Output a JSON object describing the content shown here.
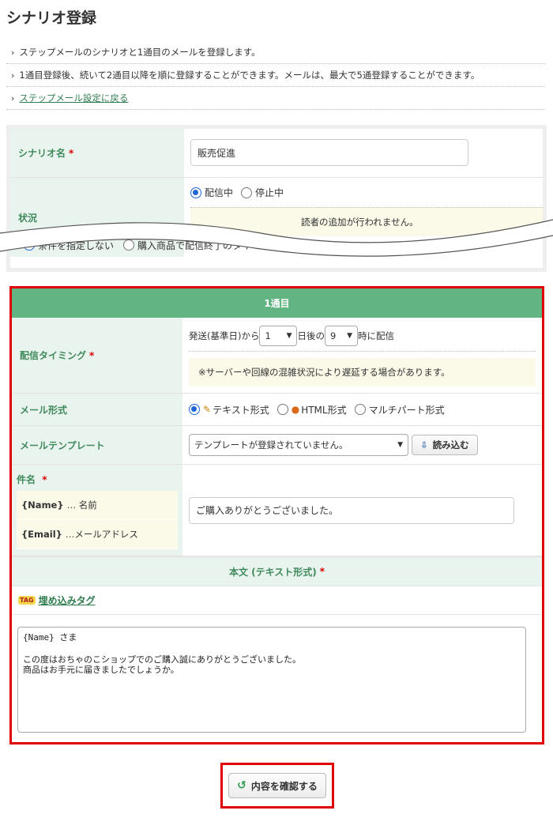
{
  "page_title": "シナリオ登録",
  "notes": [
    "ステップメールのシナリオと1通目のメールを登録します。",
    "1通目登録後、続いて2通目以降を順に登録することができます。メールは、最大で5通登録することができます。"
  ],
  "back_link": "ステップメール設定に戻る",
  "scenario": {
    "name_label": "シナリオ名",
    "required_mark": "*",
    "name_value": "販売促進",
    "status_label": "状況",
    "status_options": [
      "配信中",
      "停止中"
    ],
    "status_notice_partial": "読者の追加が行われません。",
    "condition_options_partial": [
      "条件を指定しない",
      "購入商品で配信終了のタイミング"
    ]
  },
  "mail1": {
    "header": "1通目",
    "timing_label": "配信タイミング",
    "timing_prefix": "発送(基準日)から",
    "timing_day": "1",
    "timing_mid": "日後の",
    "timing_hour": "9",
    "timing_suffix": "時に配信",
    "timing_notice": "※サーバーや回線の混雑状況により遅延する場合があります。",
    "format_label": "メール形式",
    "format_options": [
      "テキスト形式",
      "HTML形式",
      "マルチパート形式"
    ],
    "template_label": "メールテンプレート",
    "template_value": "テンプレートが登録されていません。",
    "load_button": "読み込む",
    "subject_label": "件名",
    "tags": [
      {
        "tag": "{Name}",
        "desc": "… 名前"
      },
      {
        "tag": "{Email}",
        "desc": "…メールアドレス"
      }
    ],
    "subject_value": "ご購入ありがとうございました。",
    "body_label": "本文 (テキスト形式)",
    "embed_tag_link": "埋め込みタグ",
    "body_text": "{Name} さま\n\nこの度はおちゃのこショップでのご購入誠にありがとうございました。\n商品はお手元に届きましたでしょうか。"
  },
  "confirm_button": "内容を確認する",
  "colors": {
    "label_bg": "#eaf4ee",
    "label_text": "#3f8a5c",
    "header_green": "#63b483",
    "highlight_red": "#e00000",
    "notice_bg": "#fbf9e8",
    "radio_blue": "#1e66d6"
  }
}
